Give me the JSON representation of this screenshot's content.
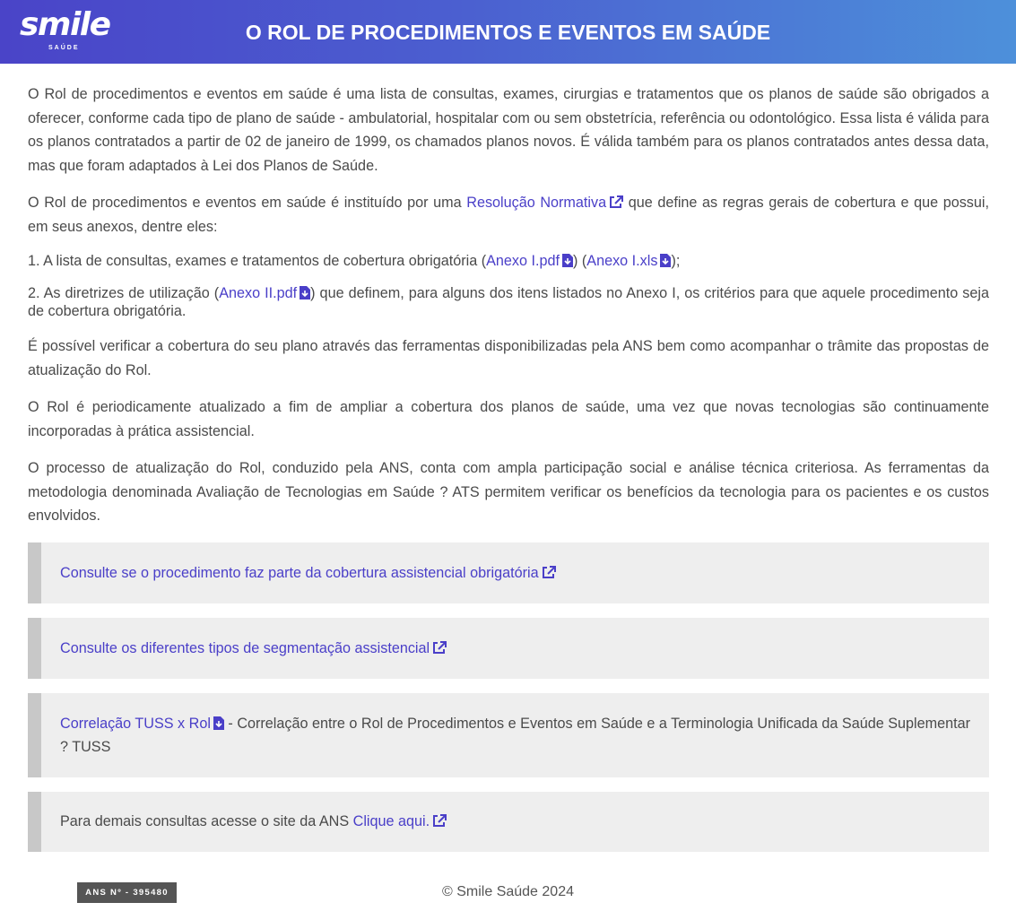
{
  "header": {
    "logo_text": "smile",
    "logo_sub": "SAÚDE",
    "title": "O ROL DE PROCEDIMENTOS E EVENTOS EM SAÚDE"
  },
  "main": {
    "p1": "O Rol de procedimentos e eventos em saúde é uma lista de consultas, exames, cirurgias e tratamentos que os planos de saúde são obrigados a oferecer, conforme cada tipo de plano de saúde - ambulatorial, hospitalar com ou sem obstetrícia, referência ou odontológico. Essa lista é válida para os planos contratados a partir de 02 de janeiro de 1999, os chamados planos novos. É válida também para os planos contratados antes dessa data, mas que foram adaptados à Lei dos Planos de Saúde.",
    "p2_before": "O Rol de procedimentos e eventos em saúde é instituído por uma ",
    "p2_link": "Resolução Normativa",
    "p2_after": " que define as regras gerais de cobertura e que possui, em seus anexos, dentre eles:",
    "item1_before": "1. A lista de consultas, exames e tratamentos de cobertura obrigatória (",
    "item1_link1": "Anexo I.pdf",
    "item1_mid": ") (",
    "item1_link2": "Anexo I.xls",
    "item1_after": ");",
    "item2_before": "2. As diretrizes de utilização (",
    "item2_link": "Anexo II.pdf",
    "item2_after": ") que definem, para alguns dos itens listados no Anexo I, os critérios para que aquele procedimento seja de cobertura obrigatória.",
    "p3": "É possível verificar a cobertura do seu plano através das ferramentas disponibilizadas pela ANS bem como acompanhar o trâmite das propostas de atualização do Rol.",
    "p4": "O Rol é periodicamente atualizado a fim de ampliar a cobertura dos planos de saúde, uma vez que novas tecnologias são continuamente incorporadas à prática assistencial.",
    "p5": "O processo de atualização do Rol, conduzido pela ANS, conta com ampla participação social e análise técnica criteriosa. As ferramentas da metodologia denominada Avaliação de Tecnologias em Saúde ? ATS permitem verificar os benefícios da tecnologia para os pacientes e os custos envolvidos."
  },
  "boxes": {
    "box1_link": "Consulte se o procedimento faz parte da cobertura assistencial obrigatória",
    "box2_link": "Consulte os diferentes tipos de segmentação assistencial",
    "box3_link": "Correlação TUSS x Rol",
    "box3_text": " - Correlação entre o Rol de Procedimentos e Eventos em Saúde e a Terminologia Unificada da Saúde Suplementar ? TUSS",
    "box4_text": "Para demais consultas acesse o site da ANS ",
    "box4_link": "Clique aqui."
  },
  "footer": {
    "ans_badge": "ANS Nº - 395480",
    "copyright": "© Smile Saúde 2024"
  },
  "colors": {
    "link": "#4a3fc8",
    "header_gradient_start": "#4a44c8",
    "header_gradient_end": "#4d90da"
  },
  "icons": {
    "external": "external-link-icon",
    "download": "file-download-icon"
  }
}
